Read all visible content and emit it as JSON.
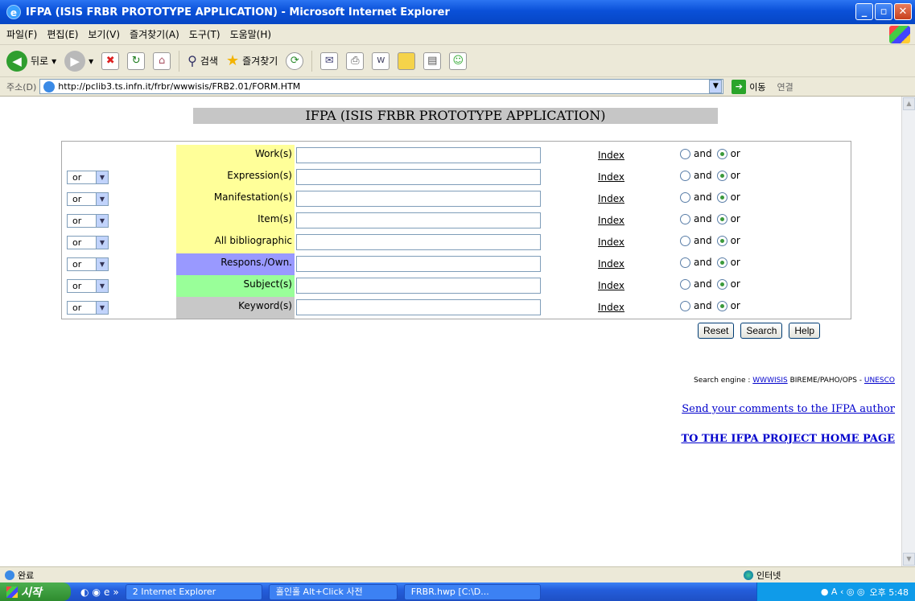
{
  "window": {
    "title": "IFPA (ISIS FRBR PROTOTYPE APPLICATION) - Microsoft Internet Explorer"
  },
  "menu": [
    "파일(F)",
    "편집(E)",
    "보기(V)",
    "즐겨찾기(A)",
    "도구(T)",
    "도움말(H)"
  ],
  "toolbar": {
    "back": "뒤로",
    "search": "검색",
    "favorites": "즐겨찾기"
  },
  "address": {
    "label": "주소(D)",
    "url": "http://pclib3.ts.infn.it/frbr/wwwisis/FRB2.01/FORM.HTM",
    "go": "이동",
    "links": "연결"
  },
  "page": {
    "title": "IFPA (ISIS FRBR PROTOTYPE APPLICATION)",
    "rows": [
      {
        "op": "",
        "label": "Work(s)",
        "color": "#ffff99"
      },
      {
        "op": "or",
        "label": "Expression(s)",
        "color": "#ffff99"
      },
      {
        "op": "or",
        "label": "Manifestation(s)",
        "color": "#ffff99"
      },
      {
        "op": "or",
        "label": "Item(s)",
        "color": "#ffff99"
      },
      {
        "op": "or",
        "label": "All bibliographic",
        "color": "#ffff99"
      },
      {
        "op": "or",
        "label": "Respons./Own.",
        "color": "#9999ff"
      },
      {
        "op": "or",
        "label": "Subject(s)",
        "color": "#99ff99"
      },
      {
        "op": "or",
        "label": "Keyword(s)",
        "color": "#c8c8c8"
      }
    ],
    "index_label": "Index",
    "and_label": "and",
    "or_label": "or",
    "buttons": {
      "reset": "Reset",
      "search": "Search",
      "help": "Help"
    },
    "engine": {
      "prefix": "Search engine : ",
      "link1": "WWWISIS",
      "middle": " BIREME/PAHO/OPS - ",
      "link2": "UNESCO"
    },
    "comments": "Send your comments to the IFPA author",
    "homepage": "TO THE IFPA PROJECT HOME PAGE"
  },
  "status": {
    "text": "완료",
    "zone": "인터넷"
  },
  "taskbar": {
    "start": "시작",
    "tasks": [
      "2 Internet Explorer",
      "홀인홀 Alt+Click 사전",
      "FRBR.hwp [C:\\D..."
    ],
    "time": "오후 5:48"
  }
}
